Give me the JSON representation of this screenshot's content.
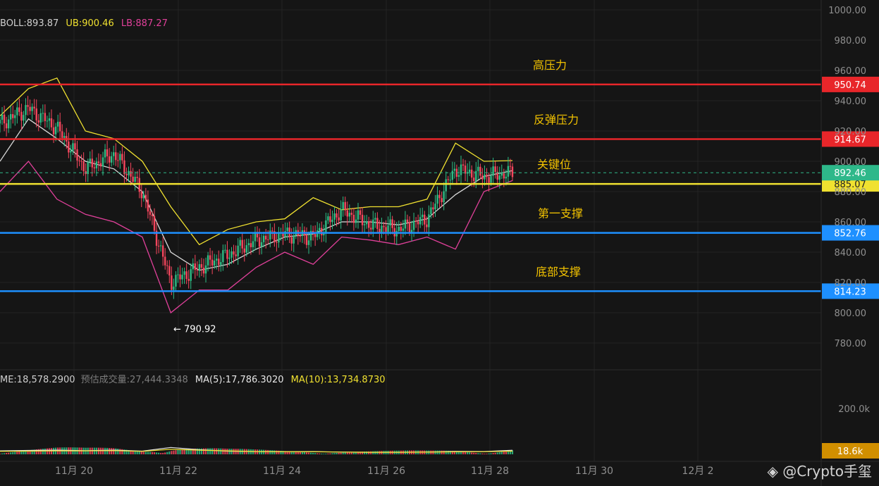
{
  "colors": {
    "background": "#151515",
    "grid": "#232323",
    "up_candle": "#2ebd85",
    "down_candle": "#f6465d",
    "boll_mid": "#d9d9d9",
    "boll_upper": "#f0e130",
    "boll_lower": "#e0409a",
    "resistance": "#e8262a",
    "key_level": "#f0e130",
    "support": "#1e90ff",
    "current_price": "#2eb88a",
    "volume_ma5": "#e6e6e6",
    "volume_ma10": "#f0e130",
    "level_text": "#f2c200"
  },
  "legend": {
    "boll": "BOLL:893.87",
    "ub": "UB:900.46",
    "lb": "LB:887.27"
  },
  "volume_legend": {
    "vol": "ME:18,578.2900",
    "est": "预估成交量:27,444.3348",
    "ma5": "MA(5):17,786.3020",
    "ma10": "MA(10):13,734.8730"
  },
  "price_axis": [
    "1000.00",
    "980.00",
    "960.00",
    "940.00",
    "920.00",
    "900.00",
    "880.00",
    "860.00",
    "840.00",
    "820.00",
    "800.00",
    "780.00"
  ],
  "volume_axis": {
    "label": "200.0k",
    "value": 200000
  },
  "date_axis": [
    "11月 20",
    "11月 22",
    "11月 24",
    "11月 26",
    "11月 28",
    "11月 30",
    "12月 2"
  ],
  "levels": [
    {
      "name": "高压力",
      "price": 950.74,
      "label": "950.74",
      "kind": "resistance"
    },
    {
      "name": "反弹压力",
      "price": 914.67,
      "label": "914.67",
      "kind": "resistance"
    },
    {
      "name": "关键位",
      "price": 885.07,
      "label": "885.07",
      "kind": "key"
    },
    {
      "name": "第一支撑",
      "price": 852.76,
      "label": "852.76",
      "kind": "support"
    },
    {
      "name": "底部支撑",
      "price": 814.23,
      "label": "814.23",
      "kind": "support"
    }
  ],
  "current_price": {
    "price": 892.46,
    "label": "892.46"
  },
  "current_volume": {
    "label": "18.6k"
  },
  "low_marker": {
    "price": 790.92,
    "label": "← 790.92"
  },
  "watermark": "◈ @Crypto手玺",
  "chart_data": {
    "type": "candlestick",
    "x": [
      "11月 19",
      "11月 19.5",
      "11月 20",
      "11月 20.5",
      "11月 21",
      "11月 21.5",
      "11月 22",
      "11月 22.5",
      "11月 23",
      "11月 23.5",
      "11月 24",
      "11月 24.5",
      "11月 25",
      "11月 25.5",
      "11月 26",
      "11月 26.5",
      "11月 27",
      "11月 27.5",
      "11月 28"
    ],
    "close": [
      925,
      935,
      922,
      895,
      905,
      880,
      820,
      830,
      838,
      848,
      852,
      850,
      868,
      858,
      855,
      862,
      895,
      890,
      892.46
    ],
    "boll_mid": [
      900,
      928,
      915,
      900,
      895,
      880,
      840,
      828,
      832,
      842,
      850,
      852,
      860,
      860,
      858,
      862,
      878,
      890,
      893.87
    ],
    "boll_upper": [
      930,
      948,
      955,
      920,
      915,
      900,
      870,
      845,
      855,
      860,
      862,
      876,
      868,
      870,
      870,
      875,
      912,
      900,
      900.46
    ],
    "boll_lower": [
      880,
      900,
      875,
      865,
      860,
      850,
      800,
      815,
      815,
      830,
      840,
      832,
      850,
      848,
      845,
      850,
      842,
      880,
      887.27
    ],
    "volume_ma5": [
      15000,
      17000,
      18000,
      16000,
      18000,
      14000,
      30000,
      20000,
      14000,
      12000,
      11000,
      12000,
      10000,
      9000,
      9000,
      10000,
      13000,
      12000,
      17786
    ],
    "volume_ma10": [
      13000,
      14000,
      15000,
      15000,
      16000,
      13000,
      22000,
      18000,
      15000,
      12000,
      11000,
      11000,
      10000,
      9000,
      9000,
      9500,
      11000,
      11500,
      13734
    ],
    "price_range": [
      770,
      1005
    ],
    "grid": true
  }
}
